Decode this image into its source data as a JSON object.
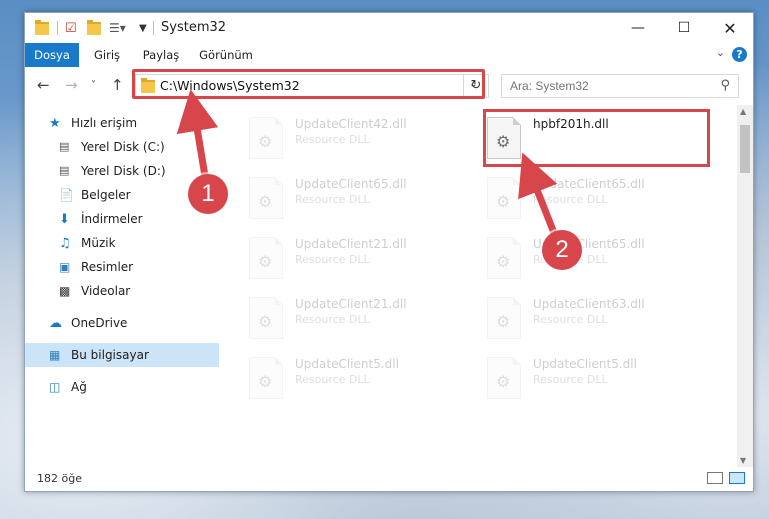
{
  "window": {
    "title": "System32"
  },
  "ribbon": {
    "tabs": [
      "Dosya",
      "Giriş",
      "Paylaş",
      "Görünüm"
    ],
    "active_tab": "Dosya",
    "help": "?"
  },
  "navigation": {
    "address": "C:\\Windows\\System32",
    "search_placeholder": "Ara: System32"
  },
  "sidebar": {
    "quick_access": "Hızlı erişim",
    "items": [
      "Yerel Disk (C:)",
      "Yerel Disk (D:)",
      "Belgeler",
      "İndirmeler",
      "Müzik",
      "Resimler",
      "Videolar"
    ],
    "onedrive": "OneDrive",
    "this_pc": "Bu bilgisayar",
    "network": "Ağ"
  },
  "files": [
    {
      "name": "UpdateClient42.dll",
      "type": "Resource DLL",
      "faded": true
    },
    {
      "name": "hpbf201h.dll",
      "type": "",
      "faded": false
    },
    {
      "name": "UpdateClient65.dll",
      "type": "Resource DLL",
      "faded": true
    },
    {
      "name": "UpdateClient65.dll",
      "type": "Resource DLL",
      "faded": true
    },
    {
      "name": "UpdateClient21.dll",
      "type": "Resource DLL",
      "faded": true
    },
    {
      "name": "UpdateClient65.dll",
      "type": "Resource DLL",
      "faded": true
    },
    {
      "name": "UpdateClient21.dll",
      "type": "Resource DLL",
      "faded": true
    },
    {
      "name": "UpdateClient63.dll",
      "type": "Resource DLL",
      "faded": true
    },
    {
      "name": "UpdateClient5.dll",
      "type": "Resource DLL",
      "faded": true
    },
    {
      "name": "UpdateClient5.dll",
      "type": "Resource DLL",
      "faded": true
    }
  ],
  "status": {
    "item_count": "182 öğe"
  },
  "callouts": {
    "one": "1",
    "two": "2"
  },
  "colors": {
    "accent": "#1979ca",
    "annotation": "#d6464b",
    "selection": "#cce4f7"
  }
}
